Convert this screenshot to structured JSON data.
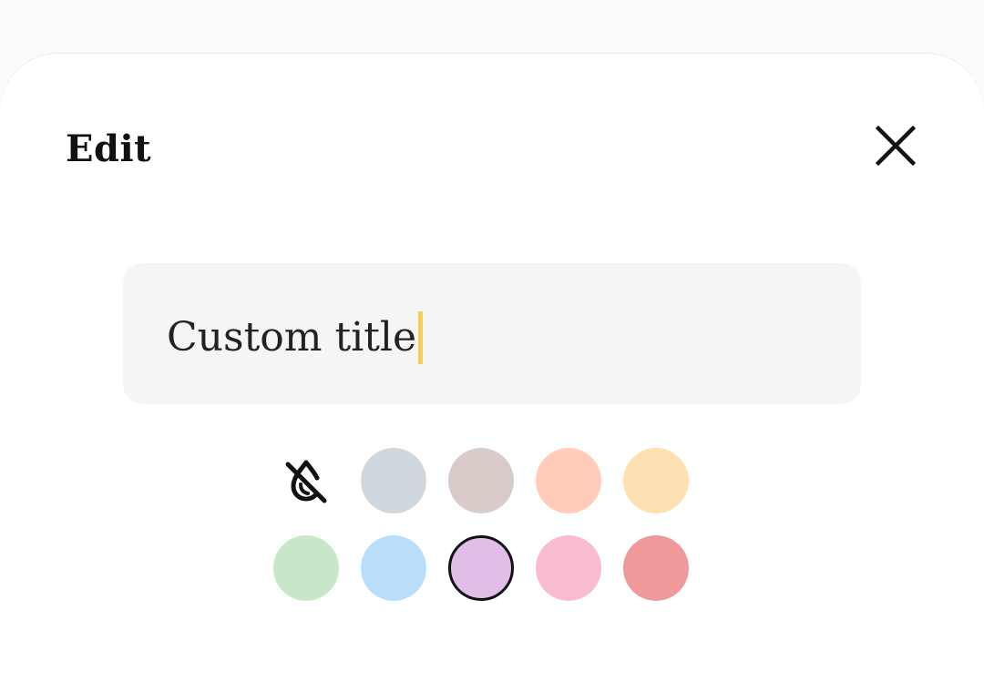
{
  "dialog": {
    "title": "Edit",
    "close_icon": "close-icon"
  },
  "title_input": {
    "value": "Custom title",
    "caret_color": "#f2cf5b"
  },
  "color_picker": {
    "no_color_icon": "no-color-drop-icon",
    "rows": [
      [
        {
          "name": "none",
          "color": "transparent",
          "selected": false
        },
        {
          "name": "gray-blue",
          "color": "#cfd8de",
          "selected": false
        },
        {
          "name": "taupe",
          "color": "#d7ccc8",
          "selected": false
        },
        {
          "name": "peach",
          "color": "#ffccbc",
          "selected": false
        },
        {
          "name": "light-orange",
          "color": "#ffe0b2",
          "selected": false
        }
      ],
      [
        {
          "name": "light-green",
          "color": "#c8e6c9",
          "selected": false
        },
        {
          "name": "light-blue",
          "color": "#bbdefb",
          "selected": false
        },
        {
          "name": "lavender",
          "color": "#e1bee7",
          "selected": true
        },
        {
          "name": "pink",
          "color": "#f8bbd0",
          "selected": false
        },
        {
          "name": "rose",
          "color": "#ef9a9a",
          "selected": false
        }
      ]
    ]
  }
}
